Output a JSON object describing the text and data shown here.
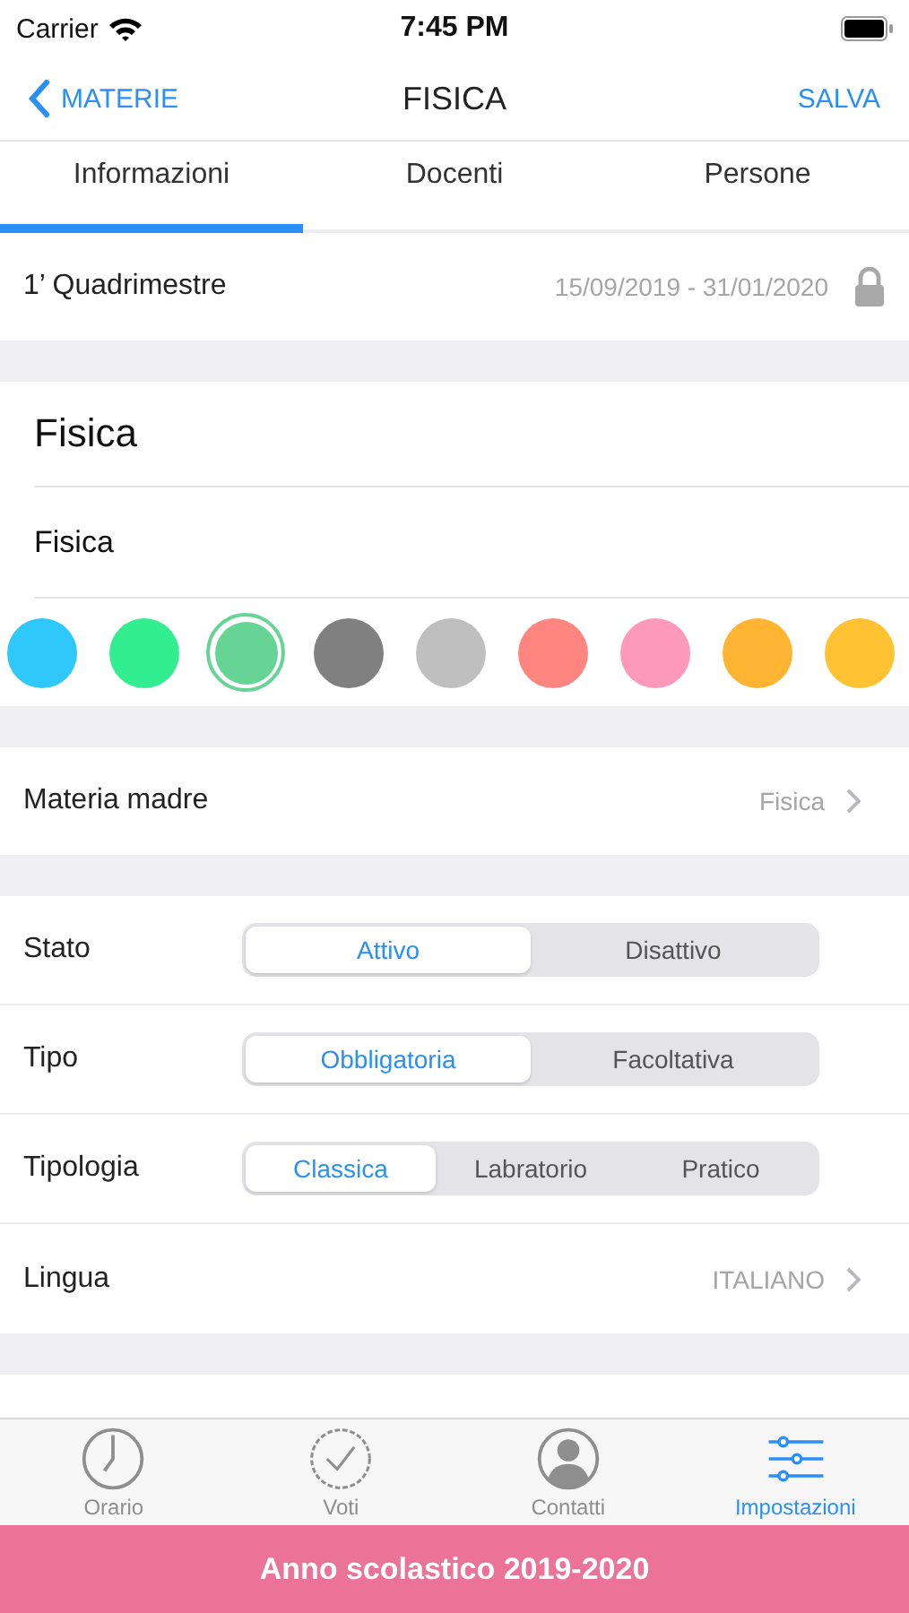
{
  "status_bar": {
    "carrier": "Carrier",
    "time": "7:45 PM"
  },
  "nav": {
    "back": "MATERIE",
    "title": "FISICA",
    "action": "SALVA"
  },
  "tabs": [
    {
      "label": "Informazioni",
      "selected": true
    },
    {
      "label": "Docenti",
      "selected": false
    },
    {
      "label": "Persone",
      "selected": false
    }
  ],
  "period": {
    "label": "1’ Quadrimestre",
    "dates": "15/09/2019 - 31/01/2020",
    "locked": true
  },
  "name_fields": [
    {
      "value": "Fisica",
      "kind": "title"
    },
    {
      "value": "Fisica",
      "kind": "short"
    }
  ],
  "colors": [
    {
      "color": "#2ec8fb",
      "selected": false
    },
    {
      "color": "#33ee90",
      "selected": false
    },
    {
      "color": "#66d494",
      "selected": true
    },
    {
      "color": "#808080",
      "selected": false
    },
    {
      "color": "#bfbfbf",
      "selected": false
    },
    {
      "color": "#ff8580",
      "selected": false
    },
    {
      "color": "#ff99bb",
      "selected": false
    },
    {
      "color": "#ffb533",
      "selected": false
    },
    {
      "color": "#ffc233",
      "selected": false
    }
  ],
  "parent": {
    "label": "Materia madre",
    "value": "Fisica"
  },
  "options": [
    {
      "kind": "segments",
      "label": "Stato",
      "segments": [
        {
          "label": "Attivo",
          "selected": true
        },
        {
          "label": "Disattivo",
          "selected": false
        }
      ]
    },
    {
      "kind": "segments",
      "label": "Tipo",
      "segments": [
        {
          "label": "Obbligatoria",
          "selected": true
        },
        {
          "label": "Facoltativa",
          "selected": false
        }
      ]
    },
    {
      "kind": "segments",
      "label": "Tipologia",
      "segments": [
        {
          "label": "Classica",
          "selected": true
        },
        {
          "label": "Labratorio",
          "selected": false
        },
        {
          "label": "Pratico",
          "selected": false
        }
      ]
    },
    {
      "kind": "link",
      "label": "Lingua",
      "value": "ITALIANO"
    }
  ],
  "tab_bar": [
    {
      "label": "Orario",
      "kind": "clock",
      "selected": false
    },
    {
      "label": "Voti",
      "kind": "check",
      "selected": false
    },
    {
      "label": "Contatti",
      "kind": "person",
      "selected": false
    },
    {
      "label": "Impostazioni",
      "kind": "sliders",
      "selected": true
    }
  ],
  "banner": "Anno scolastico 2019-2020"
}
